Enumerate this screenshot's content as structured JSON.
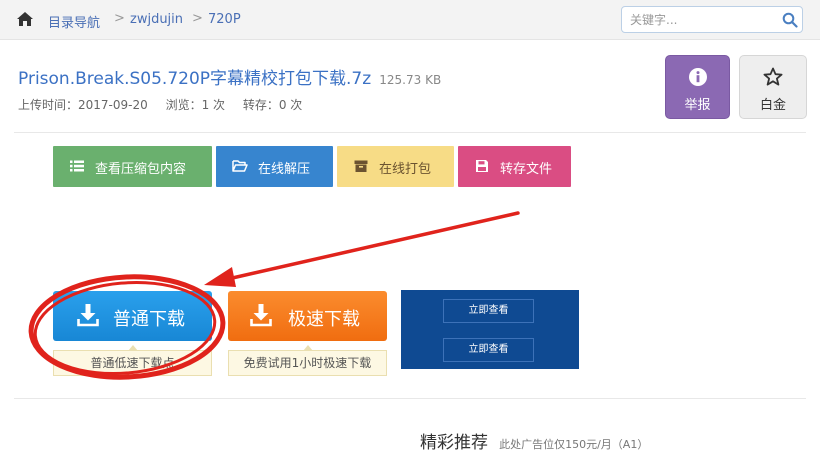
{
  "breadcrumb": {
    "items": [
      "目录导航",
      "zwjdujin",
      "720P"
    ],
    "separator": ">"
  },
  "search": {
    "placeholder": "关键字..."
  },
  "file": {
    "name": "Prison.Break.S05.720P字幕精校打包下载.7z",
    "size": "125.73 KB",
    "upload_time": "上传时间：2017-09-20",
    "views": "浏览：1 次",
    "saves": "转存：0 次"
  },
  "actions": {
    "report": "举报",
    "gold": "白金"
  },
  "tools": [
    {
      "label": "查看压缩包内容",
      "icon": "list-icon"
    },
    {
      "label": "在线解压",
      "icon": "folder-open-icon"
    },
    {
      "label": "在线打包",
      "icon": "archive-icon"
    },
    {
      "label": "转存文件",
      "icon": "save-icon"
    }
  ],
  "downloads": {
    "normal": {
      "label": "普通下载",
      "tip": "普通低速下载点"
    },
    "fast": {
      "label": "极速下载",
      "tip": "免费试用1小时极速下载"
    }
  },
  "ad": {
    "buttons": [
      "立即查看",
      "立即查看"
    ]
  },
  "recommend": {
    "title": "精彩推荐",
    "note": "此处广告位仅150元/月（A1）"
  },
  "colors": {
    "link": "#3b71c4",
    "report": "#8b69b3",
    "tool_green": "#6ab06e",
    "tool_blue": "#3785cf",
    "tool_yellow": "#f7dc86",
    "tool_pink": "#da4d83",
    "download_blue": "#1887d5",
    "download_orange": "#f06d10",
    "ad_bg": "#0f4a92",
    "annotation_red": "#e0231c"
  }
}
